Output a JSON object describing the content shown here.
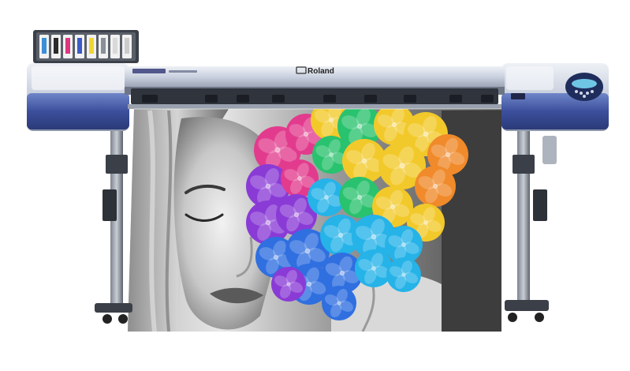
{
  "printer": {
    "brand": "Roland",
    "colors": {
      "body_blue": "#3c4f9c",
      "body_light": "#dfe4ee",
      "frame_gray": "#4a4f58",
      "panel_screen": "#6fc6e4"
    },
    "ink_cartridges": [
      {
        "color": "#3b8fd6"
      },
      {
        "color": "#2b2b2b"
      },
      {
        "color": "#e0357f"
      },
      {
        "color": "#3d5bc7"
      },
      {
        "color": "#f1d630"
      },
      {
        "color": "#8a8f99"
      },
      {
        "color": "#d9d9d9"
      },
      {
        "color": "#cccccc"
      }
    ],
    "control_panel_icon": "control-keypad"
  },
  "print": {
    "subject": "portrait-with-flowers",
    "style": "monochrome-face-rainbow-hydrangeas",
    "flower_colors": [
      "#e23b8e",
      "#8a3bd6",
      "#2f6fe0",
      "#25b3e8",
      "#29c26e",
      "#f2c92a",
      "#f08a2a"
    ]
  }
}
